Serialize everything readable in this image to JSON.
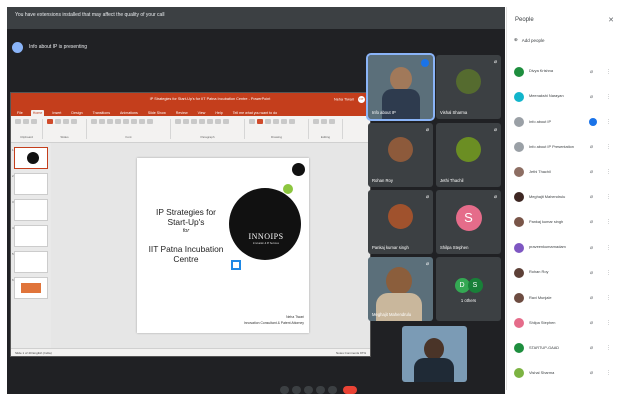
{
  "banner": {
    "text": "You have extensions installed that may affect the quality of your call"
  },
  "presenting": {
    "text": "Info about IP is presenting"
  },
  "ppt": {
    "title": "IP Strategies for Start-Up's for IIT Patna Incubation Centre - PowerPoint",
    "account": "Neha Tiwari",
    "account_initials": "NT",
    "tabs": [
      "File",
      "Home",
      "Insert",
      "Design",
      "Transitions",
      "Animations",
      "Slide Show",
      "Review",
      "View",
      "Help",
      "Tell me what you want to do"
    ],
    "active_tab": 1,
    "ribbon_groups": [
      "Clipboard",
      "Slides",
      "Font",
      "Paragraph",
      "Drawing",
      "Editing"
    ],
    "thumbnail_numbers": [
      "1",
      "2",
      "3",
      "4",
      "5",
      "6"
    ],
    "status_left": "Slide 1 of 40  English (India)",
    "status_right": "Notes  Comments  97%"
  },
  "slide": {
    "title": "IP Strategies for Start-Up's",
    "for": "for",
    "centre": "IIT Patna Incubation Centre",
    "logo": "INNOIPS",
    "logo_sub": "Innovation & IP Services",
    "speaker": "Neha Tiwari",
    "speaker_role": "Innovation Consultant & Patent Attorney"
  },
  "tiles": {
    "t1": "Info about IP",
    "t2": "Vishal Sharma",
    "t3": "Rohan Roy",
    "t4": "Jethi Thachil",
    "t5": "Pankaj kumar singh",
    "t6": "Shilpa Stephen",
    "t6_initial": "S",
    "t7": "Meghajit Mahendrulu",
    "others_label": "1 others",
    "others_avatars": [
      "D",
      "S"
    ]
  },
  "people": {
    "title": "People",
    "add": "Add people",
    "list": [
      "Divya Krishna",
      "Meenakshi Narayan",
      "Info about IP",
      "Info about IP Presentation",
      "Jethi Thachil",
      "Meghajit Mahendrulu",
      "Pankaj kumar singh",
      "praveenkumarnadam",
      "Rohan Roy",
      "Ravi Munjale",
      "Shilpa Stephen",
      "STARTUP-GAAD",
      "Vishal Sharma"
    ],
    "colors": [
      "#1e8e3e",
      "#12b5cb",
      "#9aa0a6",
      "#9aa0a6",
      "#8d6e63",
      "#3e2723",
      "#795548",
      "#7e57c2",
      "#5d4037",
      "#6d4c41",
      "#e56c8a",
      "#1e8e3e",
      "#7cb342"
    ]
  },
  "colors": {
    "accent": "#c43e1c",
    "meet_bg": "#202124",
    "tile_bg": "#3c4043",
    "end_call": "#ea4335"
  }
}
